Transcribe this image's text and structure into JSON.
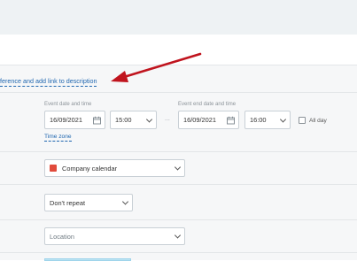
{
  "conference_link": "ference and add link to description",
  "event_start": {
    "label": "Event date and time",
    "date": "16/09/2021",
    "time": "15:00"
  },
  "separator": "...",
  "event_end": {
    "label": "Event end date and time",
    "date": "16/09/2021",
    "time": "16:00"
  },
  "all_day_label": "All day",
  "time_zone_link": "Time zone",
  "calendar": {
    "selected": "Company calendar",
    "color": "#e14b3b"
  },
  "repeat": {
    "selected": "Don't repeat"
  },
  "location": {
    "placeholder": "Location"
  },
  "colors": {
    "link": "#2067b0",
    "arrow": "#c0141e"
  },
  "icons": [
    "calendar-icon",
    "chevron-down-icon",
    "checkbox-icon",
    "arrow-annotation"
  ]
}
